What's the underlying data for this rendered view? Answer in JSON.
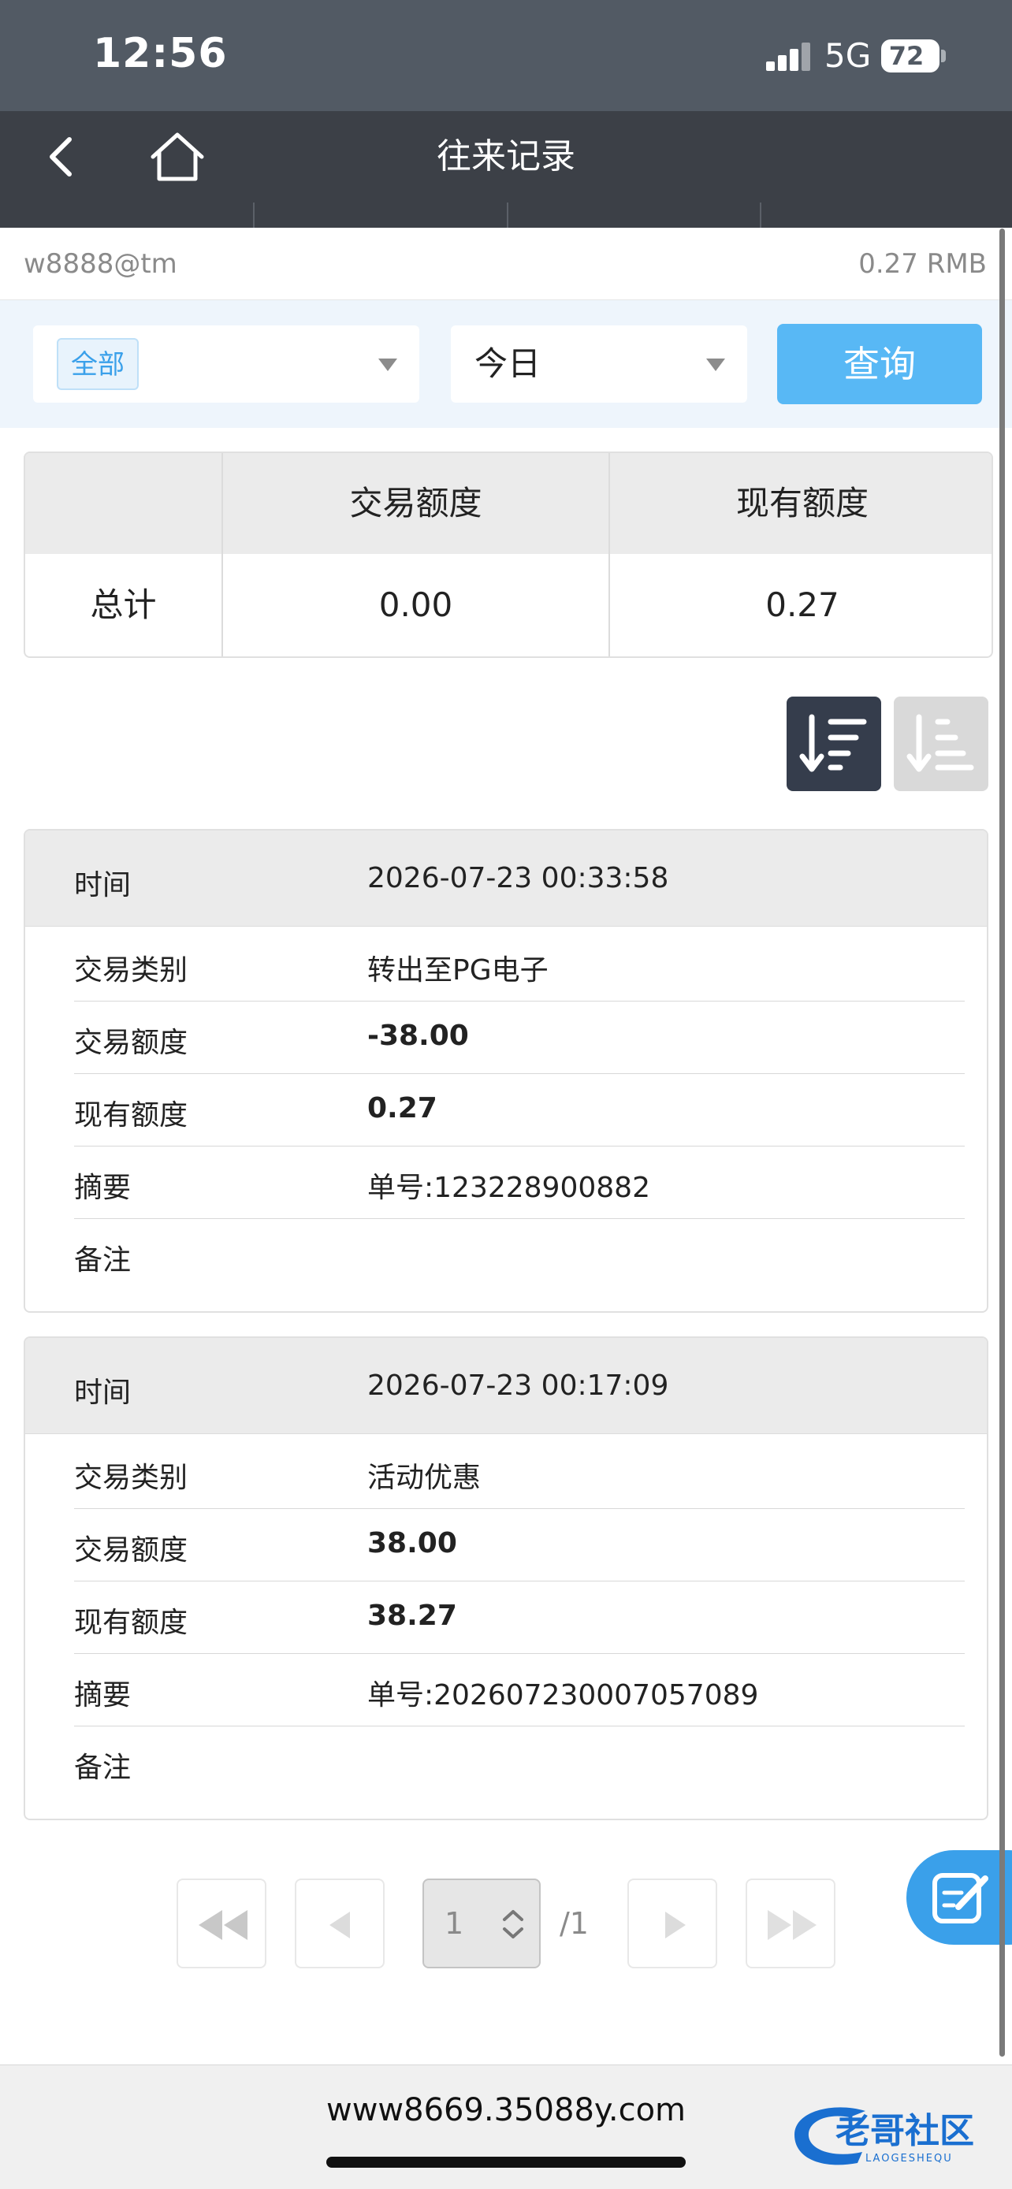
{
  "status_bar": {
    "time": "12:56",
    "network": "5G",
    "battery": "72"
  },
  "header": {
    "title": "往来记录",
    "back_icon": "chevron-left-icon",
    "home_icon": "home-icon"
  },
  "account": {
    "username": "w8888@tm",
    "balance": "0.27 RMB"
  },
  "filters": {
    "type_selected": "全部",
    "date_selected": "今日",
    "query_label": "查询"
  },
  "summary": {
    "col1": "交易额度",
    "col2": "现有额度",
    "row_label": "总计",
    "trade_amount": "0.00",
    "current_amount": "0.27"
  },
  "sort": {
    "active": "descending",
    "icons": [
      "sort-descending-icon",
      "sort-ascending-icon"
    ]
  },
  "labels": {
    "time": "时间",
    "type": "交易类别",
    "amount": "交易额度",
    "balance": "现有额度",
    "summary": "摘要",
    "remark": "备注"
  },
  "records": [
    {
      "time": "2026-07-23 00:33:58",
      "type": "转出至PG电子",
      "amount": "-38.00",
      "balance": "0.27",
      "summary": "单号:123228900882",
      "remark": ""
    },
    {
      "time": "2026-07-23 00:17:09",
      "type": "活动优惠",
      "amount": "38.00",
      "balance": "38.27",
      "summary": "单号:202607230007057089",
      "remark": ""
    }
  ],
  "pagination": {
    "current_page": "1",
    "total": "/1"
  },
  "footer": {
    "url": "www8669.35088y.com",
    "watermark_text": "老哥社区",
    "watermark_sub": "LAOGESHEQU"
  },
  "colors": {
    "header_bg": "#3c4047",
    "accent": "#58b8f5",
    "sort_active": "#353d4c"
  }
}
